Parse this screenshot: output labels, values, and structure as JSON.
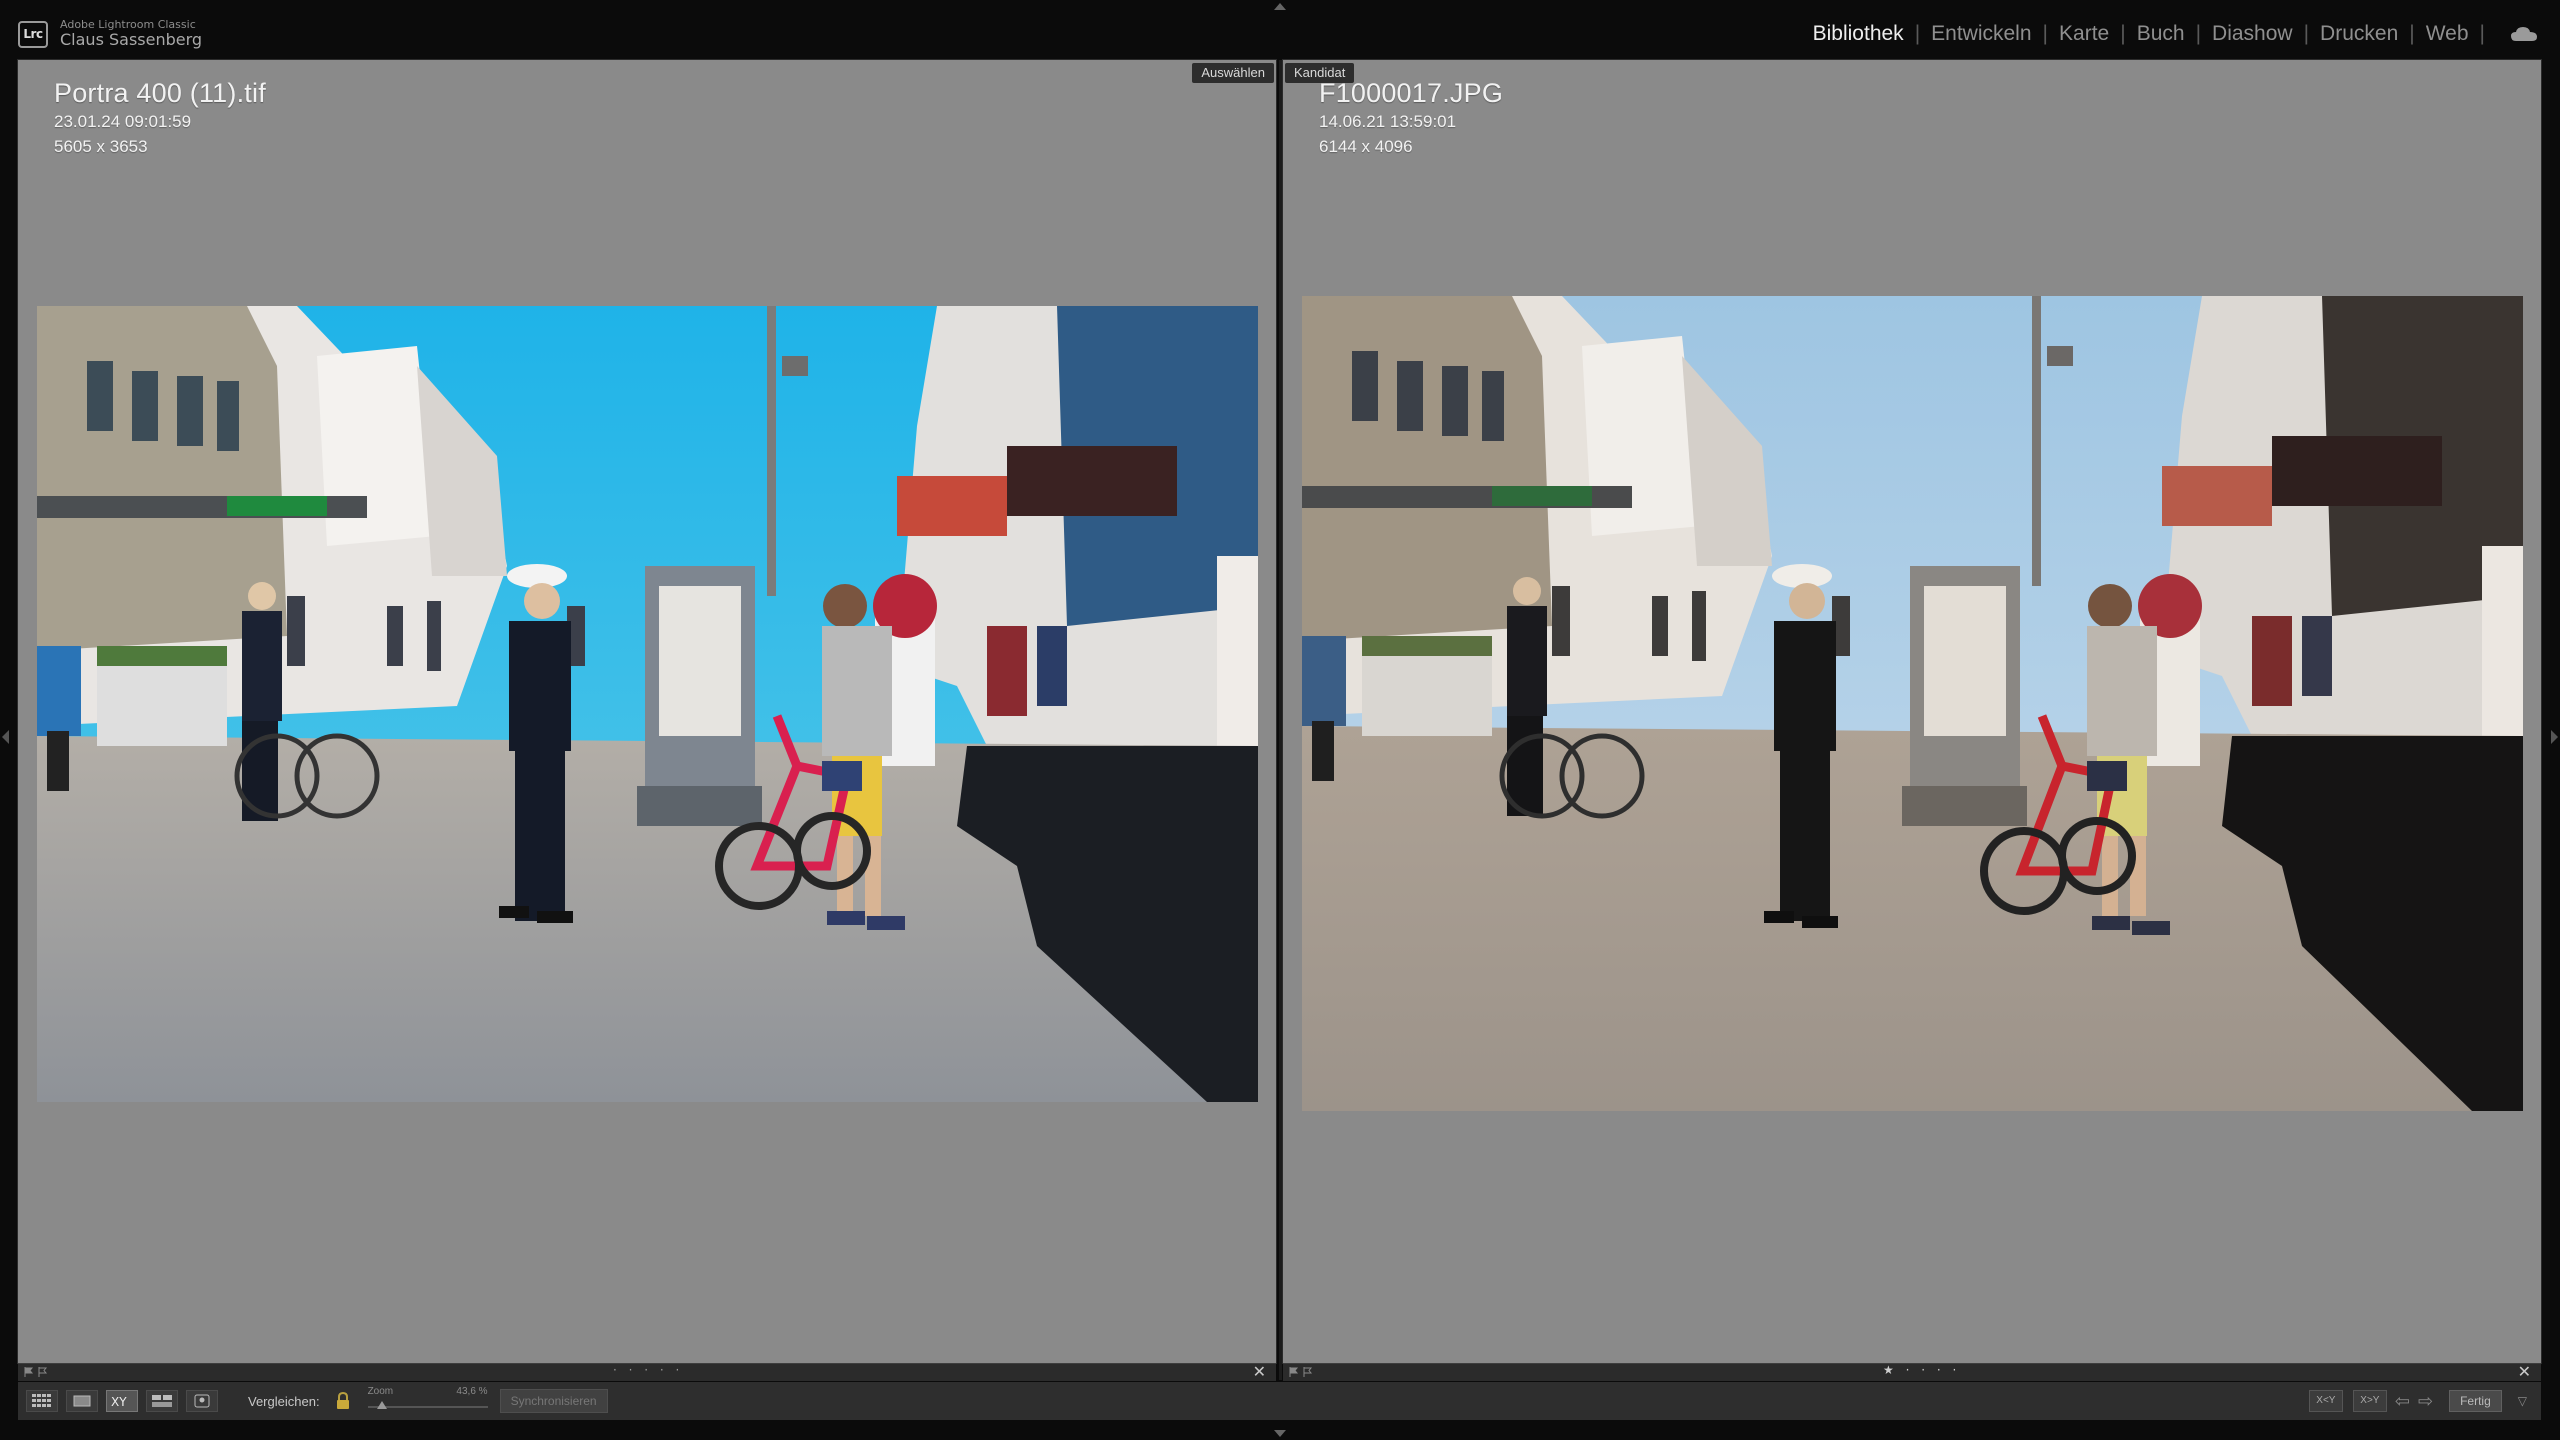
{
  "app": {
    "logo_text": "Lrc",
    "product_name": "Adobe Lightroom Classic",
    "user_name": "Claus Sassenberg"
  },
  "modules": [
    {
      "label": "Bibliothek",
      "active": true
    },
    {
      "label": "Entwickeln",
      "active": false
    },
    {
      "label": "Karte",
      "active": false
    },
    {
      "label": "Buch",
      "active": false
    },
    {
      "label": "Diashow",
      "active": false
    },
    {
      "label": "Drucken",
      "active": false
    },
    {
      "label": "Web",
      "active": false
    }
  ],
  "compare": {
    "select": {
      "badge": "Auswählen",
      "filename": "Portra 400 (11).tif",
      "datetime": "23.01.24 09:01:59",
      "dimensions": "5605 x 3653"
    },
    "candidate": {
      "badge": "Kandidat",
      "filename": "F1000017.JPG",
      "datetime": "14.06.21 13:59:01",
      "dimensions": "6144 x 4096"
    }
  },
  "toolbar": {
    "compare_label": "Vergleichen:",
    "zoom_label": "Zoom",
    "zoom_value": "43,6 %",
    "zoom_fraction": 0.12,
    "sync_label": "Synchronisieren",
    "swap_label": "X<Y",
    "swap2_label": "X>Y",
    "done_label": "Fertig",
    "view_icons": [
      "grid-view-icon",
      "loupe-view-icon",
      "compare-view-icon",
      "survey-view-icon",
      "people-view-icon"
    ],
    "active_view": "compare-view-icon"
  },
  "colors": {
    "panel_bg": "#8a8a8a",
    "app_bg": "#0b0b0b",
    "active_module": "#eeeeee",
    "inactive_module": "#8f8f8f",
    "bike_red": "#d9204f",
    "sky_left": "#2ab4e6",
    "sky_right": "#a9cbe4"
  }
}
